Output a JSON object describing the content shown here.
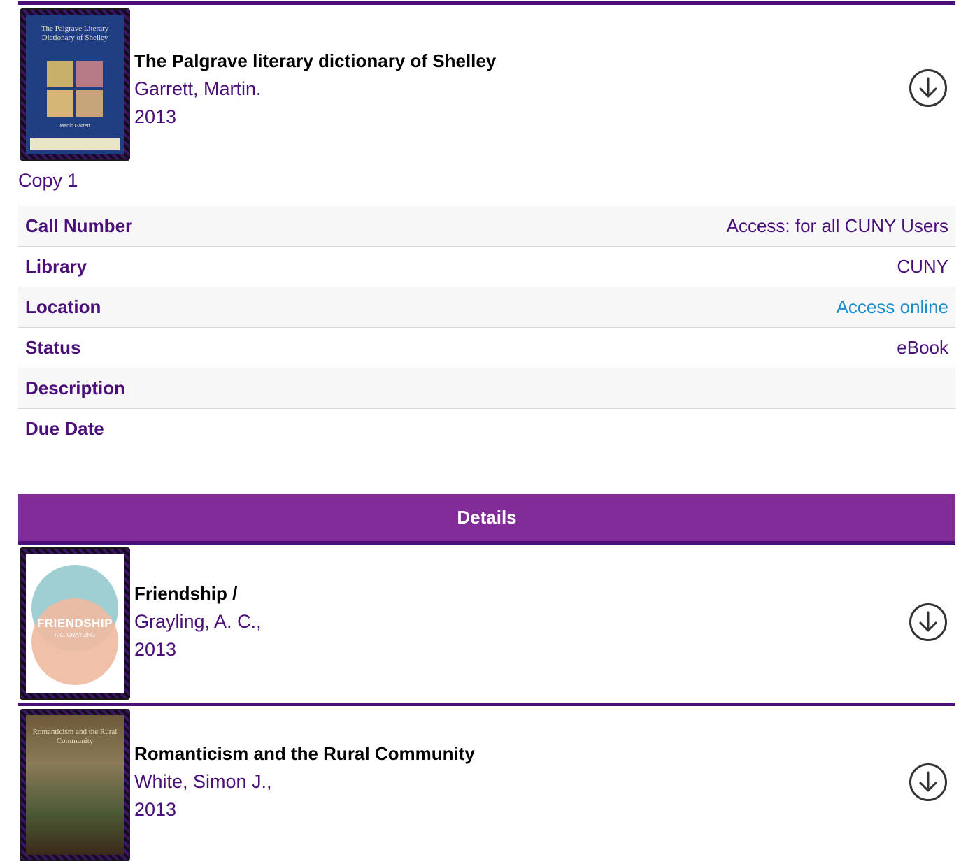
{
  "records": [
    {
      "title": "The Palgrave literary dictionary of Shelley",
      "author": "Garrett, Martin.",
      "year": "2013",
      "cover_text": "The Palgrave Literary Dictionary of Shelley",
      "cover_author": "Martin Garrett"
    },
    {
      "title": "Friendship /",
      "author": "Grayling, A. C.,",
      "year": "2013",
      "cover_text": "FRIENDSHIP",
      "cover_author": "A.C. GRAYLING"
    },
    {
      "title": "Romanticism and the Rural Community",
      "author": "White, Simon J.,",
      "year": "2013",
      "cover_text": "Romanticism and the Rural Community"
    }
  ],
  "copy": {
    "label": "Copy 1",
    "rows": [
      {
        "key": "Call Number",
        "value": "Access: for all CUNY Users"
      },
      {
        "key": "Library",
        "value": "CUNY"
      },
      {
        "key": "Location",
        "value": "Access online"
      },
      {
        "key": "Status",
        "value": "eBook"
      },
      {
        "key": "Description",
        "value": ""
      },
      {
        "key": "Due Date",
        "value": ""
      }
    ]
  },
  "details_button": "Details",
  "icons": {
    "download": "download-circle-icon"
  },
  "colors": {
    "brand_purple": "#4b0f7a",
    "button_purple": "#822c9a",
    "link_blue": "#1c8ecf"
  }
}
